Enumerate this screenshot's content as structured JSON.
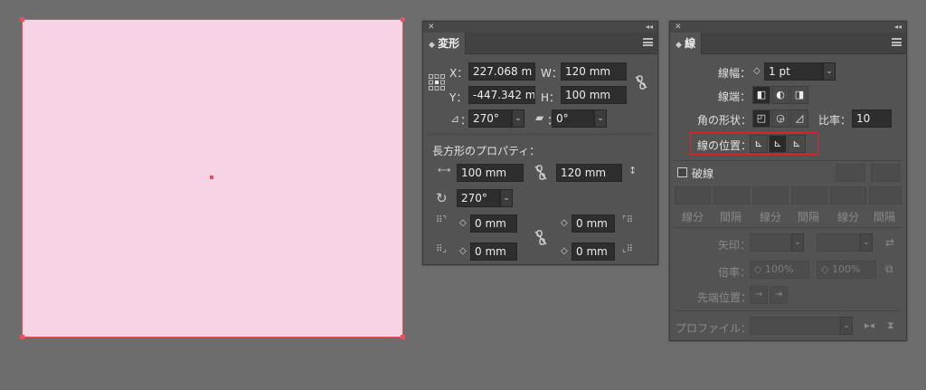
{
  "transform_panel": {
    "title": "変形",
    "x_label": "X：",
    "x_value": "227.068 m",
    "w_label": "W：",
    "w_value": "120 mm",
    "y_label": "Y：",
    "y_value": "-447.342 m",
    "h_label": "H：",
    "h_value": "100 mm",
    "angle_label": "：",
    "angle_value": "270°",
    "shear_label": "：",
    "shear_value": "0°",
    "rect_section": "長方形のプロパティ：",
    "rect_width": "100 mm",
    "rect_height": "120 mm",
    "rect_rotation": "270°",
    "corner_tl": "0 mm",
    "corner_tr": "0 mm",
    "corner_bl": "0 mm",
    "corner_br": "0 mm"
  },
  "stroke_panel": {
    "title": "線",
    "weight_label": "線幅：",
    "weight_value": "1 pt",
    "cap_label": "線端：",
    "join_label": "角の形状：",
    "limit_label": "比率：",
    "limit_value": "10",
    "align_label": "線の位置：",
    "dashed_label": "破線",
    "dash_labels": [
      "線分",
      "間隔",
      "線分",
      "間隔",
      "線分",
      "間隔"
    ],
    "arrow_label": "矢印：",
    "scale_label": "倍率：",
    "scale_value_1": "100%",
    "scale_value_2": "100%",
    "tip_label": "先端位置：",
    "profile_label": "プロファイル："
  },
  "colors": {
    "canvas": "#6d6d6d",
    "panel": "#535353",
    "art_fill": "#f7d4e5",
    "selection": "#e8505a",
    "highlight": "#e0242b"
  }
}
